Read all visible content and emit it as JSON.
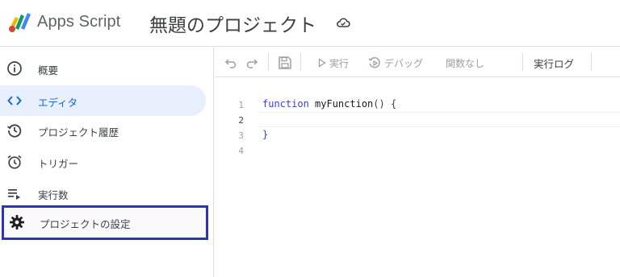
{
  "header": {
    "app_name": "Apps Script",
    "project_title": "無題のプロジェクト"
  },
  "sidebar": {
    "items": [
      {
        "label": "概要",
        "icon": "info-icon"
      },
      {
        "label": "エディタ",
        "icon": "code-icon",
        "active": true
      },
      {
        "label": "プロジェクト履歴",
        "icon": "history-icon"
      },
      {
        "label": "トリガー",
        "icon": "alarm-icon"
      },
      {
        "label": "実行数",
        "icon": "executions-icon"
      },
      {
        "label": "プロジェクトの設定",
        "icon": "gear-icon",
        "highlighted": true
      }
    ]
  },
  "toolbar": {
    "run_label": "実行",
    "debug_label": "デバッグ",
    "function_select": "関数なし",
    "log_label": "実行ログ"
  },
  "editor": {
    "line_numbers": [
      "1",
      "2",
      "3",
      "4"
    ],
    "current_line": "2",
    "code": {
      "line1_keyword": "function",
      "line1_name": "myFunction",
      "line1_rest": "() {",
      "line3": "}"
    }
  },
  "colors": {
    "accent": "#1967d2",
    "active_bg": "#e8f0fe",
    "highlight_border": "#2f33b8",
    "keyword": "#3344cc"
  }
}
